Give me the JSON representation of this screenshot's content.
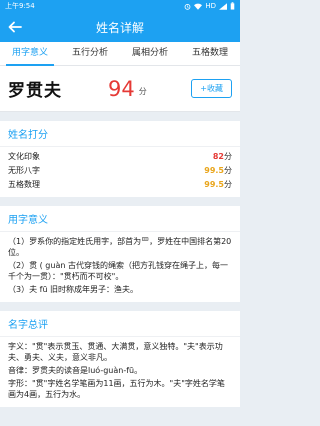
{
  "status": {
    "time": "上午9:54",
    "network": "HD"
  },
  "header": {
    "title": "姓名详解"
  },
  "tabs": [
    "用字意义",
    "五行分析",
    "属相分析",
    "五格数理"
  ],
  "card": {
    "name": "罗贯夫",
    "score": "94",
    "unit": "分",
    "collect_label": "+收藏"
  },
  "score_section": {
    "title": "姓名打分",
    "rows": [
      {
        "label": "文化印象",
        "value": "82",
        "unit": "分"
      },
      {
        "label": "无形八字",
        "value": "99.5",
        "unit": "分"
      },
      {
        "label": "五格数理",
        "value": "99.5",
        "unit": "分"
      }
    ]
  },
  "meaning_section": {
    "title": "用字意义",
    "lines": [
      "（1）罗系你的指定姓氏用字，部首为罒，罗姓在中国排名第20位。",
      "（2）贯 ( guàn 古代穿钱的绳索（把方孔钱穿在绳子上，每一千个为一贯）：\"贯朽而不可校\"。",
      "（3）夫 fū 旧时称成年男子：渔夫。"
    ]
  },
  "summary_section": {
    "title": "名字总评",
    "lines": [
      "字义：\"贯\"表示贯玉、贯通、大满贯，意义独特。\"夫\"表示功夫、勇夫、义夫，意义非凡。",
      "音律：罗贯夫的读音是luó-guàn-fū。",
      "字形：\"贯\"字姓名学笔画为11画，五行为木。\"夫\"字姓名学笔画为4画，五行为水。"
    ]
  }
}
